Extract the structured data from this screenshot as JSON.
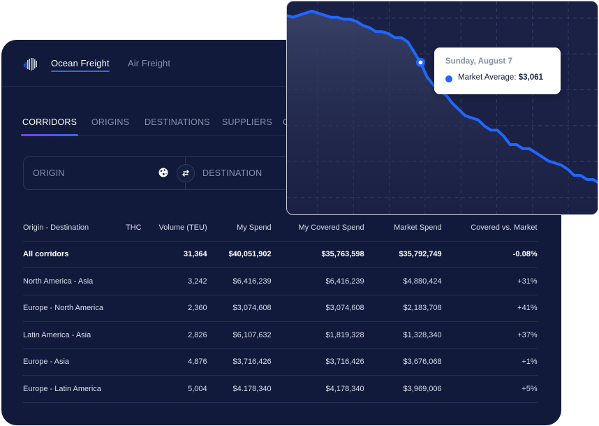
{
  "topbar": {
    "tabs": [
      {
        "label": "Ocean Freight",
        "active": true
      },
      {
        "label": "Air Freight",
        "active": false
      }
    ]
  },
  "subtabs": [
    {
      "label": "CORRIDORS",
      "active": true
    },
    {
      "label": "ORIGINS",
      "active": false
    },
    {
      "label": "DESTINATIONS",
      "active": false
    },
    {
      "label": "SUPPLIERS",
      "active": false
    },
    {
      "label": "C",
      "active": false
    }
  ],
  "filter": {
    "origin_placeholder": "ORIGIN",
    "destination_placeholder": "DESTINATION",
    "icons": {
      "origin": "globe-icon",
      "swap": "swap-arrows-icon"
    }
  },
  "table": {
    "headers": [
      "Origin - Destination",
      "THC",
      "Volume (TEU)",
      "My Spend",
      "My Covered Spend",
      "Market Spend",
      "Covered vs. Market"
    ],
    "total": {
      "name": "All corridors",
      "thc": "",
      "volume": "31,364",
      "my_spend": "$40,051,902",
      "covered": "$35,763,598",
      "market": "$35,792,749",
      "vs_market": "-0.08%"
    },
    "rows": [
      {
        "name": "North America - Asia",
        "thc": "",
        "volume": "3,242",
        "my_spend": "$6,416,239",
        "covered": "$6,416,239",
        "market": "$4,880,424",
        "vs_market": "+31%"
      },
      {
        "name": "Europe - North America",
        "thc": "",
        "volume": "2,360",
        "my_spend": "$3,074,608",
        "covered": "$3,074,608",
        "market": "$2,183,708",
        "vs_market": "+41%"
      },
      {
        "name": "Latin America - Asia",
        "thc": "",
        "volume": "2,826",
        "my_spend": "$6,107,632",
        "covered": "$1,819,328",
        "market": "$1,328,340",
        "vs_market": "+37%"
      },
      {
        "name": "Europe - Asia",
        "thc": "",
        "volume": "4,876",
        "my_spend": "$3,716,426",
        "covered": "$3,716,426",
        "market": "$3,676,068",
        "vs_market": "+1%"
      },
      {
        "name": "Europe - Latin America",
        "thc": "",
        "volume": "5,004",
        "my_spend": "$4.178,340",
        "covered": "$4,178,340",
        "market": "$3,969,006",
        "vs_market": "+5%"
      }
    ]
  },
  "chart_data": {
    "type": "line",
    "title": "",
    "xlabel": "",
    "ylabel": "",
    "grid": true,
    "series": [
      {
        "name": "Market Average",
        "color": "#2266ff",
        "values": [
          96,
          95,
          96,
          97,
          98,
          97,
          96,
          95,
          95,
          94,
          94,
          93,
          91,
          90,
          88,
          88,
          87,
          85,
          85,
          83,
          78,
          73,
          66,
          62,
          59,
          57,
          53,
          50,
          47,
          46,
          45,
          42,
          40,
          40,
          37,
          33,
          33,
          31,
          31,
          29,
          27,
          25,
          24,
          23,
          21,
          18,
          18,
          16,
          16,
          14
        ]
      }
    ],
    "ylim": [
      0,
      100
    ],
    "highlight_index": 21,
    "tooltip": {
      "date": "Sunday, August 7",
      "label": "Market Average:",
      "value": "$3,061"
    }
  }
}
